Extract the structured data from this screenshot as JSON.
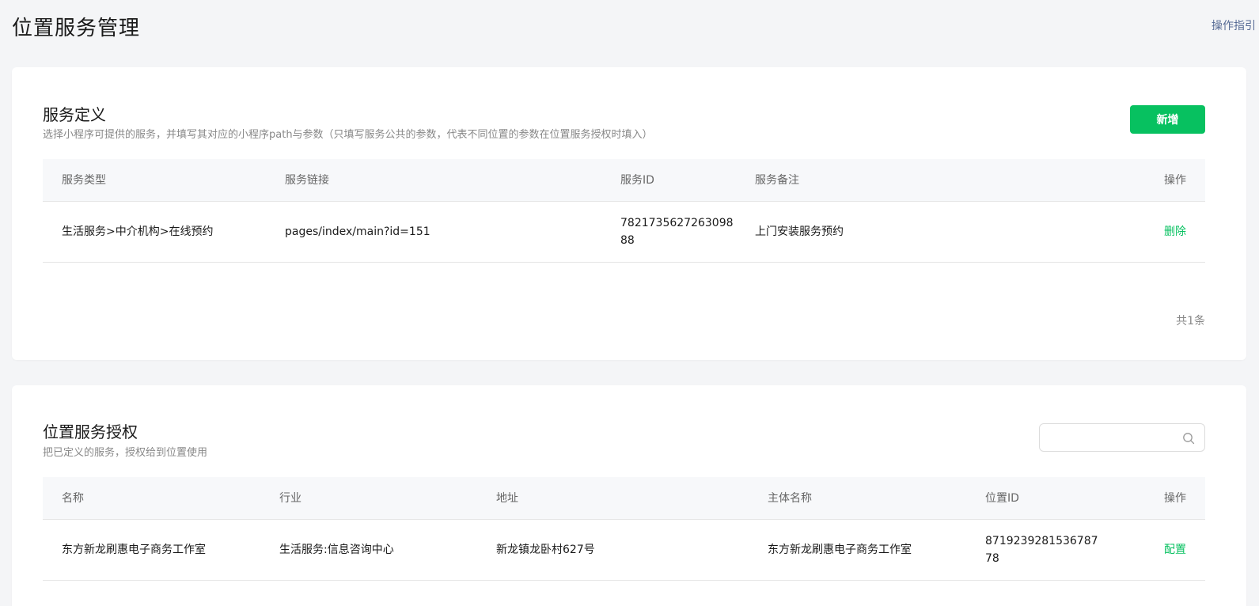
{
  "header": {
    "title": "位置服务管理",
    "guide_link": "操作指引"
  },
  "service_definition": {
    "title": "服务定义",
    "description": "选择小程序可提供的服务，并填写其对应的小程序path与参数（只填写服务公共的参数，代表不同位置的参数在位置服务授权时填入）",
    "add_button": "新增",
    "columns": [
      "服务类型",
      "服务链接",
      "服务ID",
      "服务备注",
      "操作"
    ],
    "rows": [
      {
        "type": "生活服务>中介机构>在线预约",
        "link": "pages/index/main?id=151",
        "id": "782173562726309888",
        "note": "上门安装服务预约",
        "action": "删除"
      }
    ],
    "total": "共1条"
  },
  "location_authorization": {
    "title": "位置服务授权",
    "description": "把已定义的服务，授权给到位置使用",
    "search": {
      "placeholder": "",
      "value": ""
    },
    "columns": [
      "名称",
      "行业",
      "地址",
      "主体名称",
      "位置ID",
      "操作"
    ],
    "rows": [
      {
        "name": "东方新龙刷惠电子商务工作室",
        "industry": "生活服务:信息咨询中心",
        "address": "新龙镇龙卧村627号",
        "entity": "东方新龙刷惠电子商务工作室",
        "location_id": "871923928153678778",
        "action": "配置"
      }
    ]
  },
  "colors": {
    "accent": "#07c160",
    "link": "#576b95",
    "background": "#f4f5f7"
  }
}
